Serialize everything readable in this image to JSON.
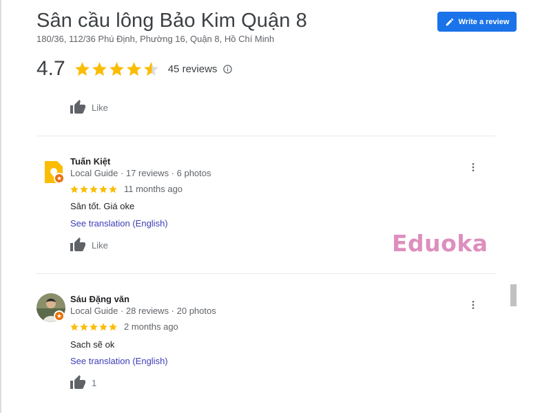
{
  "place": {
    "title": "Sân cầu lông Bảo Kim Quận 8",
    "address": "180/36, 112/36 Phú Định, Phường 16, Quận 8, Hồ Chí Minh",
    "rating": "4.7",
    "rating_value": 4.7,
    "review_count": "45 reviews"
  },
  "actions": {
    "write_review": "Write a review"
  },
  "previous_review": {
    "like_label": "Like"
  },
  "reviews": [
    {
      "name": "Tuấn Kiệt",
      "meta": "Local Guide · 17 reviews · 6 photos",
      "stars": 5,
      "time": "11 months ago",
      "text": "Sân tốt. Giá oke",
      "translate": "See translation (English)",
      "like_label": "Like"
    },
    {
      "name": "Sáu Đặng văn",
      "meta": "Local Guide · 28 reviews · 20 photos",
      "stars": 5,
      "time": "2 months ago",
      "text": "Sach sẽ ok",
      "translate": "See translation (English)",
      "like_label": "1"
    }
  ],
  "watermark": "Eduoka",
  "colors": {
    "accent": "#1a73e8",
    "star": "#fbbc04",
    "local_guide_badge": "#e8710a",
    "watermark": "#dd8fbe"
  },
  "icons": [
    "pencil-icon",
    "star-icon",
    "info-icon",
    "thumb-up-icon",
    "more-vert-icon",
    "local-guide-badge-icon"
  ]
}
